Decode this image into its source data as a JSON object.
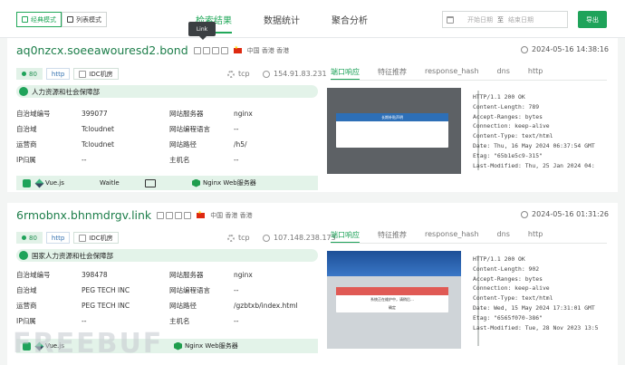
{
  "header": {
    "view_modes": [
      {
        "label": "经典模式",
        "active": true
      },
      {
        "label": "列表模式",
        "active": false
      }
    ],
    "tabs": [
      {
        "label": "检索结果",
        "active": true
      },
      {
        "label": "数据统计",
        "active": false
      },
      {
        "label": "聚合分析",
        "active": false
      }
    ],
    "start_date_placeholder": "开始日期",
    "range_separator": "至",
    "end_date_placeholder": "结束日期",
    "export_label": "导出",
    "tooltip": "Link"
  },
  "results": [
    {
      "domain": "aq0nzcx.soeeawouresd2.bond",
      "location": "中国 香港 香港",
      "time": "2024-05-16 14:38:16",
      "port": "80",
      "protocol": "http",
      "idc": "IDC机房",
      "transport": "tcp",
      "ip": "154.91.83.231",
      "org": "人力资源和社会保障部",
      "left_labels": [
        "自治域编号",
        "自治域",
        "运营商",
        "IP归属"
      ],
      "left_values": [
        "399077",
        "Tcloudnet",
        "Tcloudnet",
        "--"
      ],
      "right_labels": [
        "网站服务器",
        "网站编程语言",
        "网站路径",
        "主机名"
      ],
      "right_values": [
        "nginx",
        "--",
        "/h5/",
        "--"
      ],
      "tech": [
        "Vue.js",
        "Waitle",
        "Nginx Web服务器"
      ],
      "rtabs": [
        "端口响应",
        "特征推荐",
        "response_hash",
        "dns",
        "http"
      ],
      "dialog_title": "长期补贴声明",
      "response": "HTTP/1.1 200 OK\nContent-Length: 789\nAccept-Ranges: bytes\nConnection: keep-alive\nContent-Type: text/html\nDate: Thu, 16 May 2024 06:37:54 GMT\nEtag: \"65b1e5c9-315\"\nLast-Modified: Thu, 25 Jan 2024 04:"
    },
    {
      "domain": "6rmobnx.bhnmdrgv.link",
      "location": "中国 香港 香港",
      "time": "2024-05-16 01:31:26",
      "port": "80",
      "protocol": "http",
      "idc": "IDC机房",
      "transport": "tcp",
      "ip": "107.148.238.173",
      "org": "国家人力资源和社会保障部",
      "left_labels": [
        "自治域编号",
        "自治域",
        "运营商",
        "IP归属"
      ],
      "left_values": [
        "398478",
        "PEG TECH INC",
        "PEG TECH INC",
        "--"
      ],
      "right_labels": [
        "网站服务器",
        "网站编程语言",
        "网站路径",
        "主机名"
      ],
      "right_values": [
        "nginx",
        "--",
        "/gzbtxb/index.html",
        "--"
      ],
      "tech": [
        "Vue.js",
        "",
        "Nginx Web服务器"
      ],
      "rtabs": [
        "端口响应",
        "特征推荐",
        "response_hash",
        "dns",
        "http"
      ],
      "dialog_title": "系统正在维护中，请稍后…",
      "dialog_button": "确定",
      "response": "HTTP/1.1 200 OK\nContent-Length: 902\nAccept-Ranges: bytes\nConnection: keep-alive\nContent-Type: text/html\nDate: Wed, 15 May 2024 17:31:01 GMT\nEtag: \"6565f070-386\"\nLast-Modified: Tue, 28 Nov 2023 13:5"
    }
  ],
  "watermark": "FREEBUF",
  "colors": {
    "accent": "#1fa35a",
    "domain": "#1d7e4a",
    "org_bg": "#e3f3e9"
  }
}
